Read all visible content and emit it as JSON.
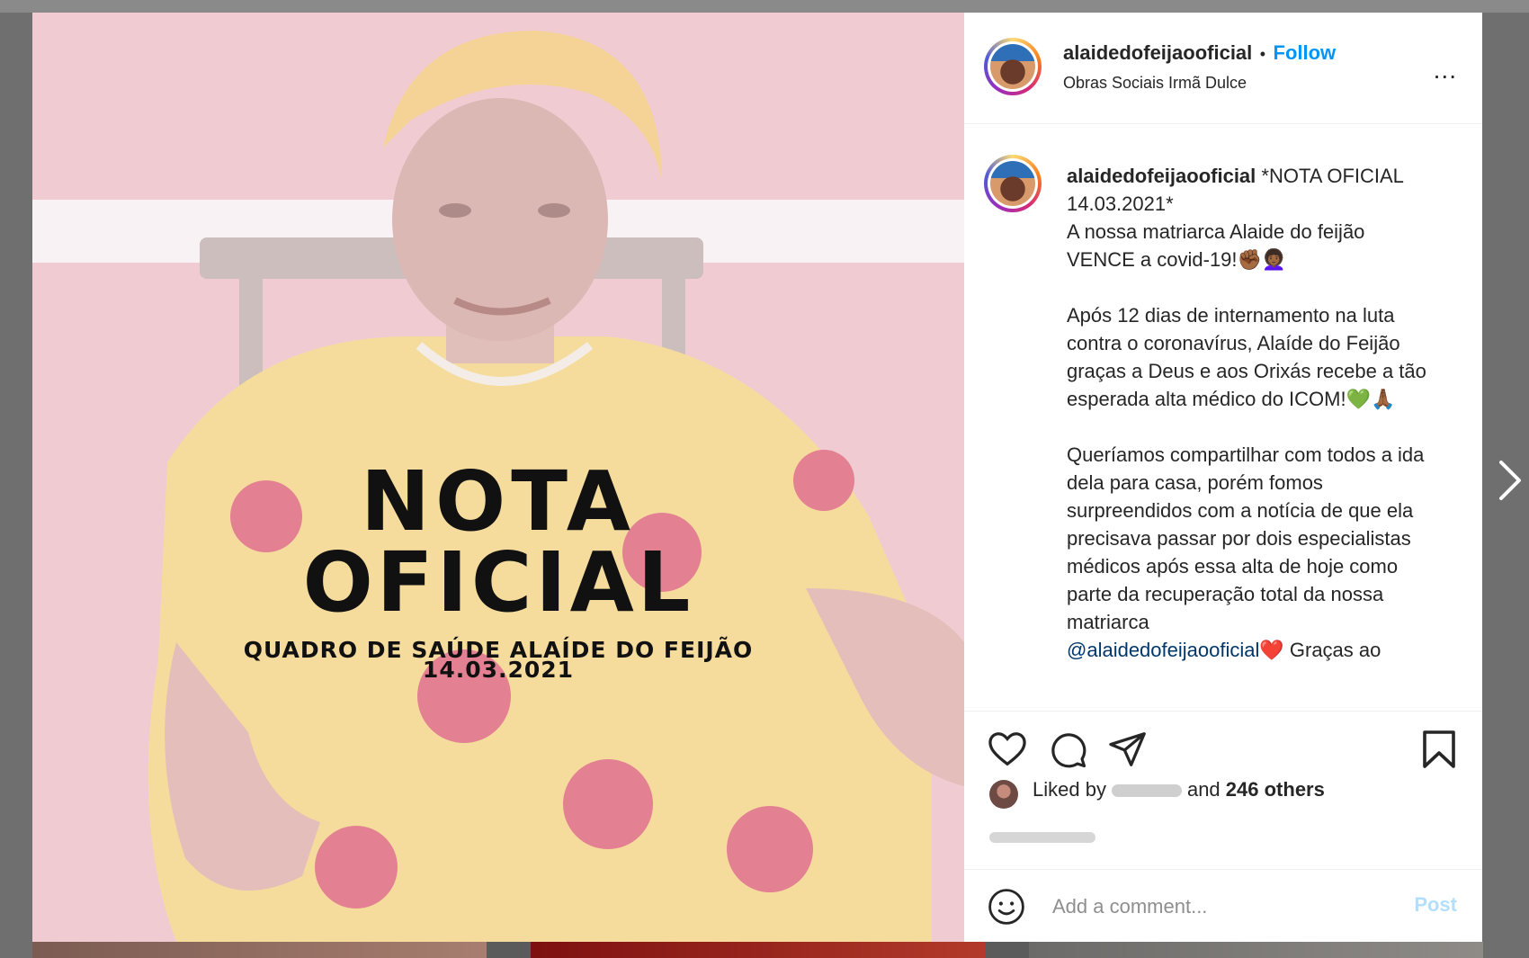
{
  "header": {
    "username": "alaidedofeijaooficial",
    "separator": "•",
    "follow_label": "Follow",
    "location": "Obras Sociais Irmã Dulce",
    "more_label": "..."
  },
  "post_image": {
    "line1": "NOTA",
    "line2": "OFICIAL",
    "line3": "QUADRO DE SAÚDE ALAÍDE DO FEIJÃO",
    "line4": "14.03.2021"
  },
  "caption": {
    "username": "alaidedofeijaooficial",
    "text_part1": " *NOTA OFICIAL 14.03.2021*\nA nossa matriarca Alaide do feijão VENCE a covid-19!✊🏾👩🏾‍🦱\n\nApós 12 dias de internamento na luta contra o coronavírus, Alaíde do Feijão graças a Deus e aos Orixás recebe a tão esperada alta médico do ICOM!💚🙏🏾\n\nQueríamos compartilhar com todos a ida dela para casa, porém fomos surpreendidos com a notícia de que ela precisava passar por dois especialistas médicos após essa alta de hoje como parte da recuperação total da nossa matriarca\n",
    "mention": "@alaidedofeijaooficial",
    "text_part2": "❤️ Graças ao"
  },
  "likes": {
    "prefix": "Liked by",
    "middle": "and",
    "count_label": "246 others"
  },
  "comment": {
    "placeholder": "Add a comment...",
    "post_label": "Post"
  },
  "colors": {
    "accent": "#0095f6",
    "post_disabled": "#b2dffc",
    "text": "#262626",
    "overlay_bg": "#6f6f6f"
  },
  "icons": [
    "more-options-icon",
    "heart-icon",
    "comment-icon",
    "share-icon",
    "bookmark-icon",
    "emoji-icon",
    "next-arrow-icon"
  ]
}
